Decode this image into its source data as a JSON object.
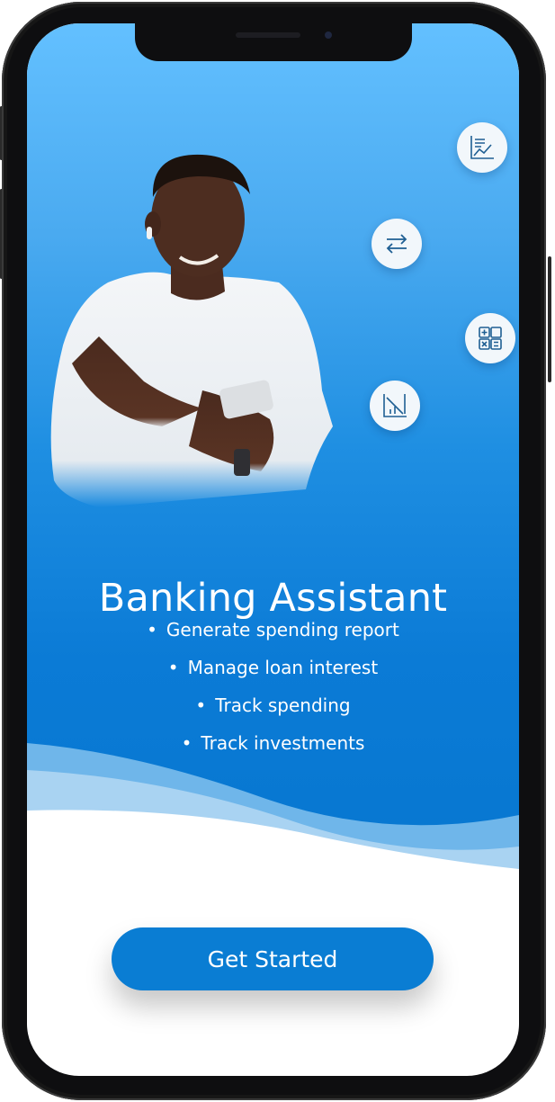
{
  "onboarding": {
    "title": "Banking Assistant",
    "features": [
      "Generate spending report",
      "Manage loan interest",
      "Track spending",
      "Track investments"
    ],
    "cta_label": "Get Started"
  },
  "feature_icons": [
    "line-chart-report-icon",
    "transfer-arrows-icon",
    "calculator-grid-icon",
    "declining-chart-icon"
  ],
  "colors": {
    "sky_top": "#63c0ff",
    "sky_bottom": "#0777d0",
    "button_blue": "#0a7dd3",
    "icon_stroke": "#1f5f93",
    "text": "#ffffff"
  }
}
